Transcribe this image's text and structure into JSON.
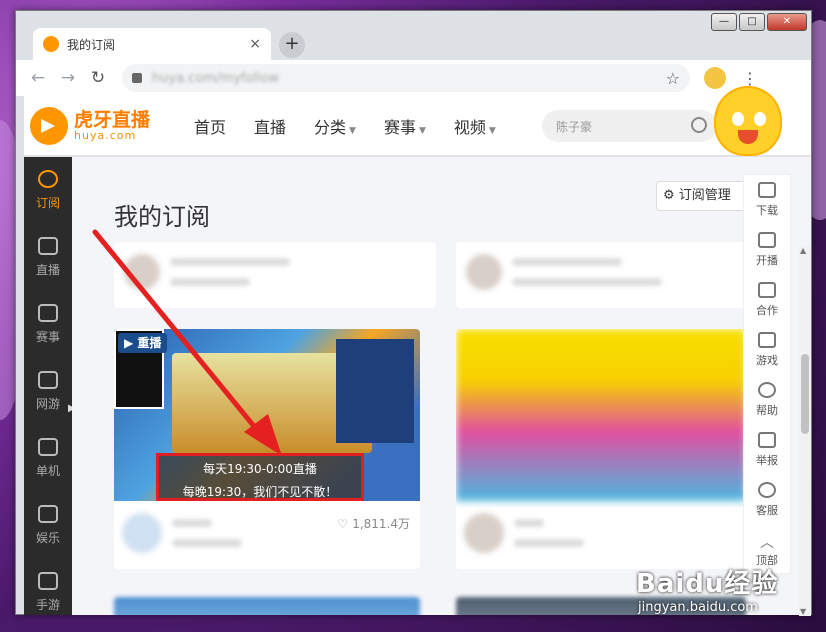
{
  "browser": {
    "tab_title": "我的订阅",
    "tab_close": "×",
    "new_tab": "+",
    "url": "huya.com/myfollow",
    "win_min": "—",
    "win_max": "□",
    "win_close": "✕"
  },
  "header": {
    "logo_cn": "虎牙直播",
    "logo_en": "huya.com",
    "nav": [
      {
        "label": "首页",
        "caret": false
      },
      {
        "label": "直播",
        "caret": false
      },
      {
        "label": "分类",
        "caret": true
      },
      {
        "label": "赛事",
        "caret": true
      },
      {
        "label": "视频",
        "caret": true
      }
    ],
    "search_placeholder": "陈子豪"
  },
  "sidebar": {
    "items": [
      "订阅",
      "直播",
      "赛事",
      "网游",
      "单机",
      "娱乐",
      "手游"
    ]
  },
  "main": {
    "title": "我的订阅",
    "manage_label": "订阅管理",
    "replay_badge": "重播",
    "overlay_line1": "每天19:30-0:00直播",
    "overlay_line2": "每晚19:30，我们不见不散！",
    "likes": "1,811.4万"
  },
  "float_bar": {
    "items": [
      "下载",
      "开播",
      "合作",
      "游戏",
      "帮助",
      "举报",
      "客服",
      "顶部"
    ]
  },
  "watermark": {
    "top": "Baidu经验",
    "bottom": "jingyan.baidu.com"
  },
  "colors": {
    "accent": "#ff9600",
    "highlight": "#e02020",
    "sidebar_bg": "#2b2b2b"
  }
}
